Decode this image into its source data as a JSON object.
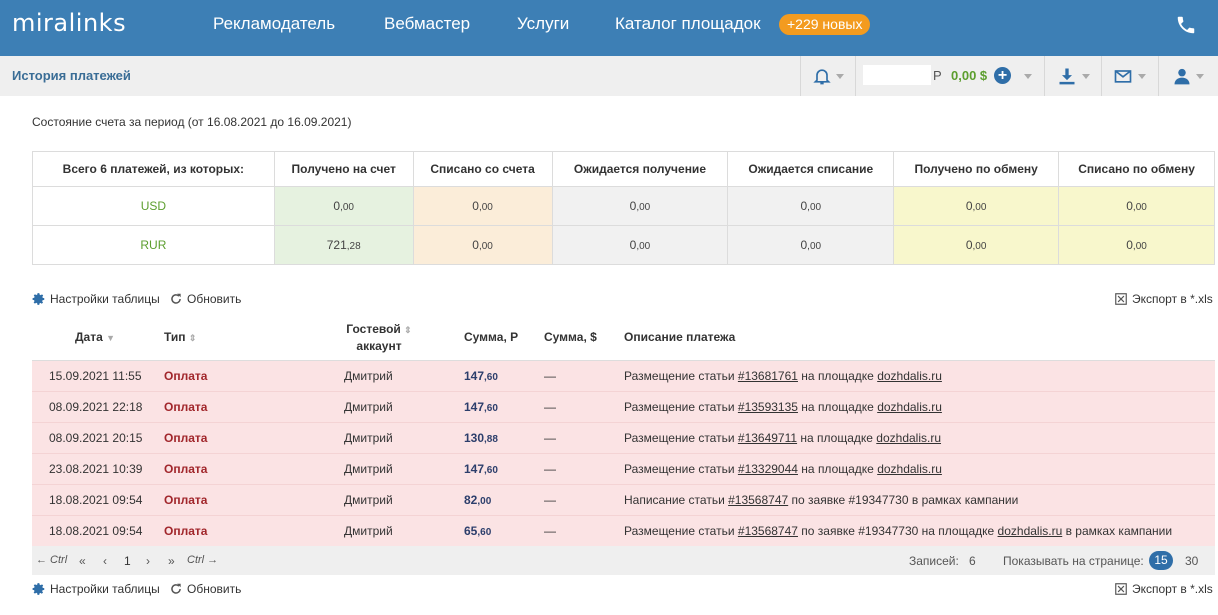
{
  "header": {
    "logo": "miralinks",
    "nav": [
      "Рекламодатель",
      "Вебмастер",
      "Услуги",
      "Каталог площадок"
    ],
    "catalog_badge": "+229 новых",
    "brand_color": "#3d7fb5",
    "badge_color": "#f39b1f"
  },
  "subbar": {
    "title": "История платежей",
    "rub_sign": "Р",
    "usd_balance": "0,00 $"
  },
  "period_text": "Состояние счета за период (от 16.08.2021 до 16.09.2021)",
  "summary": {
    "headers": [
      "Всего 6 платежей, из которых:",
      "Получено на счет",
      "Списано со счета",
      "Ожидается получение",
      "Ожидается списание",
      "Получено по обмену",
      "Списано по обмену"
    ],
    "rows": [
      {
        "currency": "USD",
        "values": [
          [
            "0",
            ",00"
          ],
          [
            "0",
            ",00"
          ],
          [
            "0",
            ",00"
          ],
          [
            "0",
            ",00"
          ],
          [
            "0",
            ",00"
          ],
          [
            "0",
            ",00"
          ]
        ]
      },
      {
        "currency": "RUR",
        "values": [
          [
            "721",
            ",28"
          ],
          [
            "0",
            ",00"
          ],
          [
            "0",
            ",00"
          ],
          [
            "0",
            ",00"
          ],
          [
            "0",
            ",00"
          ],
          [
            "0",
            ",00"
          ]
        ]
      }
    ]
  },
  "toolbar": {
    "settings": "Настройки таблицы",
    "refresh": "Обновить",
    "export": "Экспорт в *.xls"
  },
  "payments": {
    "headers": {
      "date": "Дата",
      "type": "Тип",
      "guest_line1": "Гостевой",
      "guest_line2": "аккаунт",
      "sum_rub": "Сумма, Р",
      "sum_usd": "Сумма, $",
      "description": "Описание платежа"
    },
    "rows": [
      {
        "date": "15.09.2021 11:55",
        "type": "Оплата",
        "guest": "Дмитрий",
        "sum_int": "147",
        "sum_frac": ",60",
        "usd": "—",
        "desc": [
          {
            "t": "Размещение статьи "
          },
          {
            "t": "#13681761",
            "link": true
          },
          {
            "t": " на площадке "
          },
          {
            "t": "dozhdalis.ru",
            "link": true
          }
        ]
      },
      {
        "date": "08.09.2021 22:18",
        "type": "Оплата",
        "guest": "Дмитрий",
        "sum_int": "147",
        "sum_frac": ",60",
        "usd": "—",
        "desc": [
          {
            "t": "Размещение статьи "
          },
          {
            "t": "#13593135",
            "link": true
          },
          {
            "t": " на площадке "
          },
          {
            "t": "dozhdalis.ru",
            "link": true
          }
        ]
      },
      {
        "date": "08.09.2021 20:15",
        "type": "Оплата",
        "guest": "Дмитрий",
        "sum_int": "130",
        "sum_frac": ",88",
        "usd": "—",
        "desc": [
          {
            "t": "Размещение статьи "
          },
          {
            "t": "#13649711",
            "link": true
          },
          {
            "t": " на площадке "
          },
          {
            "t": "dozhdalis.ru",
            "link": true
          }
        ]
      },
      {
        "date": "23.08.2021 10:39",
        "type": "Оплата",
        "guest": "Дмитрий",
        "sum_int": "147",
        "sum_frac": ",60",
        "usd": "—",
        "desc": [
          {
            "t": "Размещение статьи "
          },
          {
            "t": "#13329044",
            "link": true
          },
          {
            "t": " на площадке "
          },
          {
            "t": "dozhdalis.ru",
            "link": true
          }
        ]
      },
      {
        "date": "18.08.2021 09:54",
        "type": "Оплата",
        "guest": "Дмитрий",
        "sum_int": "82",
        "sum_frac": ",00",
        "usd": "—",
        "desc": [
          {
            "t": "Написание статьи "
          },
          {
            "t": "#13568747",
            "link": true
          },
          {
            "t": " по заявке #19347730 в рамках кампании"
          }
        ]
      },
      {
        "date": "18.08.2021 09:54",
        "type": "Оплата",
        "guest": "Дмитрий",
        "sum_int": "65",
        "sum_frac": ",60",
        "usd": "—",
        "desc": [
          {
            "t": "Размещение статьи "
          },
          {
            "t": "#13568747",
            "link": true
          },
          {
            "t": " по заявке #19347730 на площадке "
          },
          {
            "t": "dozhdalis.ru",
            "link": true
          },
          {
            "t": " в рамках кампании"
          }
        ]
      }
    ]
  },
  "pager": {
    "prev_ctrl": "← Ctrl",
    "first": "«",
    "prev": "‹",
    "page": "1",
    "next": "›",
    "last": "»",
    "next_ctrl": "Ctrl →",
    "records_label": "Записей:",
    "records": "6",
    "per_page_label": "Показывать на странице:",
    "per_page_active": "15",
    "per_page_other": "30"
  }
}
